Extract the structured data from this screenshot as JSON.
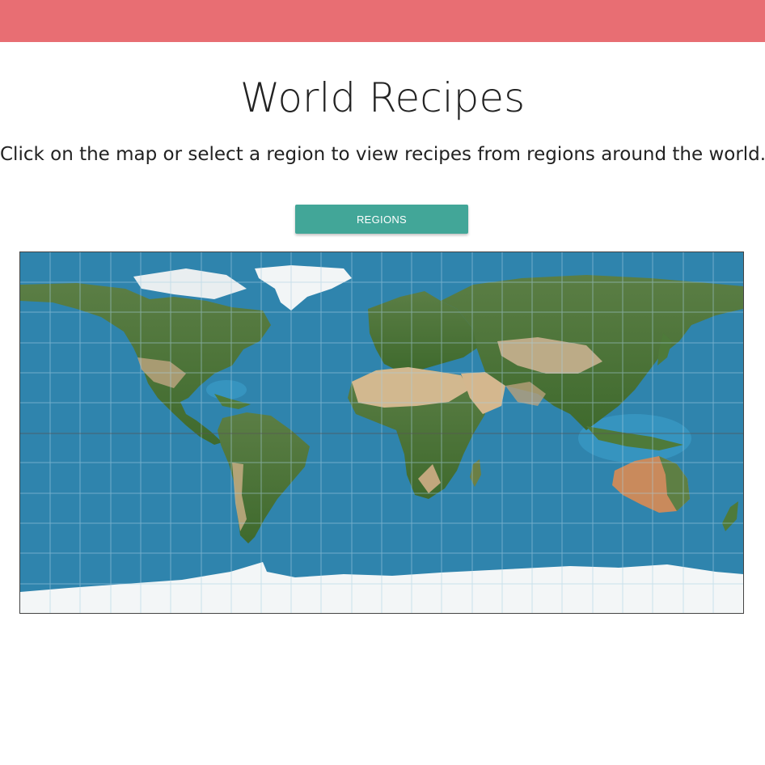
{
  "header": {
    "bar_color": "#e86e73"
  },
  "page": {
    "title": "World Recipes",
    "subtitle": "Click on the map or select a region to view recipes from regions around the world."
  },
  "controls": {
    "regions_label": "REGIONS",
    "button_color": "#42a698"
  },
  "map": {
    "type": "equirectangular world satellite map",
    "colors": {
      "ocean": "#2f84ad",
      "land": "#4e7a3a",
      "desert": "#cfb38a",
      "ice": "#f3f6f7",
      "grid": "#9fc8dc"
    },
    "regions": [
      "north-america",
      "greenland",
      "south-america",
      "europe",
      "africa",
      "asia",
      "australia",
      "antarctica"
    ]
  }
}
